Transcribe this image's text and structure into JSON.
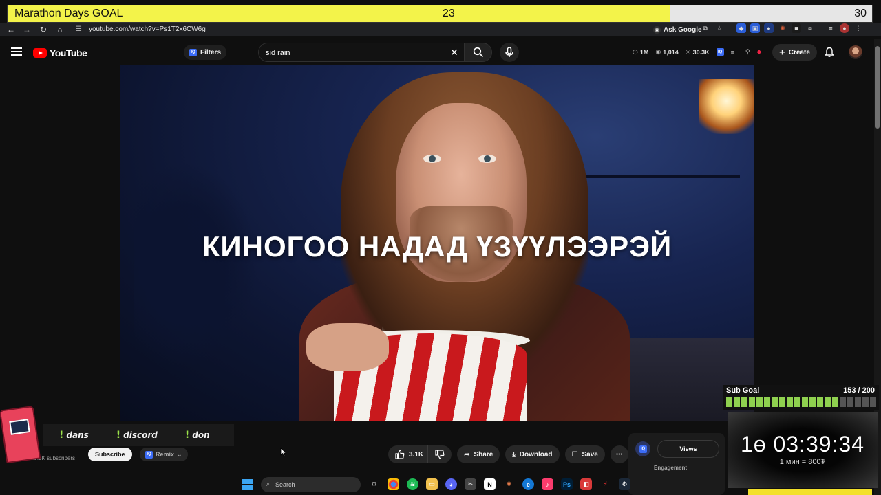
{
  "overlay": {
    "goal": {
      "title": "Marathon Days GOAL",
      "current": "23",
      "target": "30",
      "progress": 0.7667
    },
    "commands": [
      {
        "label": "dans"
      },
      {
        "label": "discord"
      },
      {
        "label": "don"
      }
    ],
    "sub_goal": {
      "label": "Sub Goal",
      "count": "153 / 200",
      "segments_total": 20,
      "segments_filled": 15
    },
    "timer": {
      "value": "1ө 03:39:34",
      "rate": "1 мин = 800₮"
    }
  },
  "browser": {
    "url": "youtube.com/watch?v=Ps1T2x6CW6g",
    "ask_google": "Ask Google"
  },
  "youtube": {
    "logo": "YouTube",
    "filters_label": "Filters",
    "search_value": "sid rain",
    "stats": {
      "views": "1M",
      "watchers": "1,014",
      "likes": "30.3K"
    },
    "create_label": "Create",
    "video_caption": "КИНОГОО НАДАД ҮЗҮҮЛЭЭРЭЙ",
    "channel": {
      "subscribers": "49.5K subscribers",
      "subscribe_label": "Subscribe",
      "remix_label": "Remix"
    },
    "actions": {
      "likes": "3.1K",
      "share": "Share",
      "download": "Download",
      "save": "Save"
    },
    "panel": {
      "views_tab": "Views",
      "engagement": "Engagement"
    }
  },
  "taskbar": {
    "search_label": "Search"
  },
  "colors": {
    "goal_fill": "#f3f34a",
    "youtube_red": "#ff0000",
    "sub_goal_on": "#8fd14f",
    "command_accent": "#9be24a"
  }
}
